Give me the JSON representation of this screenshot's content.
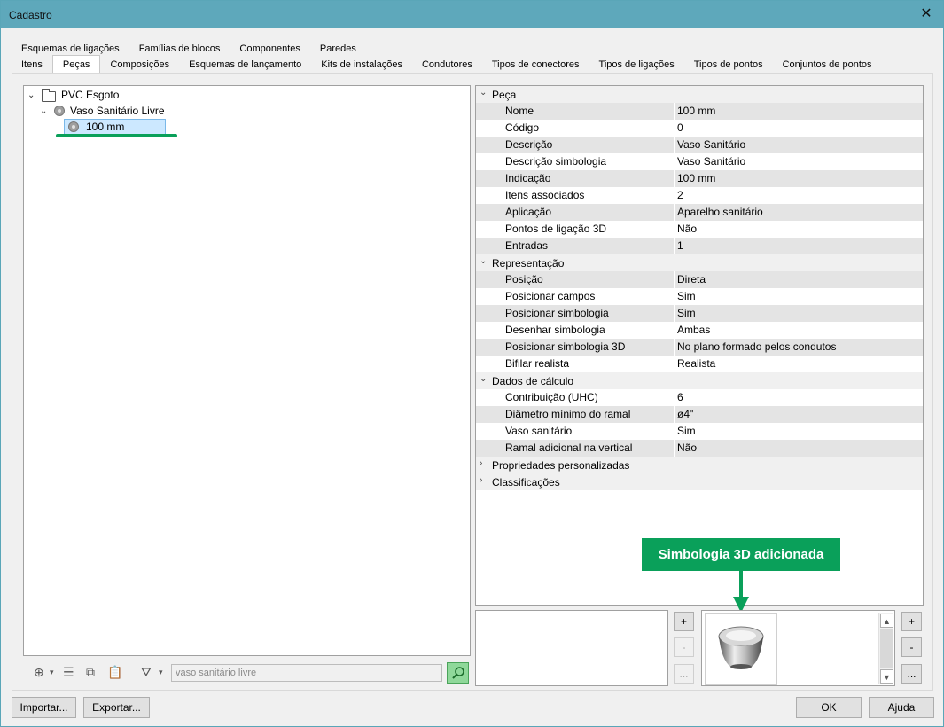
{
  "window": {
    "title": "Cadastro"
  },
  "tabs_row1": [
    "Esquemas de ligações",
    "Famílias de blocos",
    "Componentes",
    "Paredes"
  ],
  "tabs_row2": [
    "Itens",
    "Peças",
    "Composições",
    "Esquemas de lançamento",
    "Kits de instalações",
    "Condutores",
    "Tipos de conectores",
    "Tipos de ligações",
    "Tipos de pontos",
    "Conjuntos de pontos"
  ],
  "active_tab": "Peças",
  "tree": {
    "root": "PVC Esgoto",
    "child": "Vaso Sanitário Livre",
    "grandchild": "100 mm"
  },
  "search": {
    "value": "vaso sanitário livre"
  },
  "properties": {
    "cat1": "Peça",
    "peca": [
      [
        "Nome",
        "100 mm"
      ],
      [
        "Código",
        "0"
      ],
      [
        "Descrição",
        "Vaso Sanitário"
      ],
      [
        "Descrição simbologia",
        "Vaso Sanitário"
      ],
      [
        "Indicação",
        "100 mm"
      ],
      [
        "Itens associados",
        "2"
      ],
      [
        "Aplicação",
        "Aparelho sanitário"
      ],
      [
        "Pontos de ligação 3D",
        "Não"
      ],
      [
        "Entradas",
        "1"
      ]
    ],
    "cat2": "Representação",
    "representacao": [
      [
        "Posição",
        "Direta"
      ],
      [
        "Posicionar campos",
        "Sim"
      ],
      [
        "Posicionar simbologia",
        "Sim"
      ],
      [
        "Desenhar simbologia",
        "Ambas"
      ],
      [
        "Posicionar simbologia 3D",
        "No plano formado pelos condutos"
      ],
      [
        "Bifilar realista",
        "Realista"
      ]
    ],
    "cat3": "Dados de cálculo",
    "calculo": [
      [
        "Contribuição (UHC)",
        "6"
      ],
      [
        "Diâmetro mínimo do ramal",
        "ø4\""
      ],
      [
        "Vaso sanitário",
        "Sim"
      ],
      [
        "Ramal adicional na vertical",
        "Não"
      ]
    ],
    "cat4": "Propriedades personalizadas",
    "cat5": "Classificações"
  },
  "callout": "Simbologia 3D adicionada",
  "side_buttons": {
    "add": "+",
    "remove": "-",
    "more": "..."
  },
  "footer": {
    "import": "Importar...",
    "export": "Exportar...",
    "ok": "OK",
    "help": "Ajuda"
  }
}
